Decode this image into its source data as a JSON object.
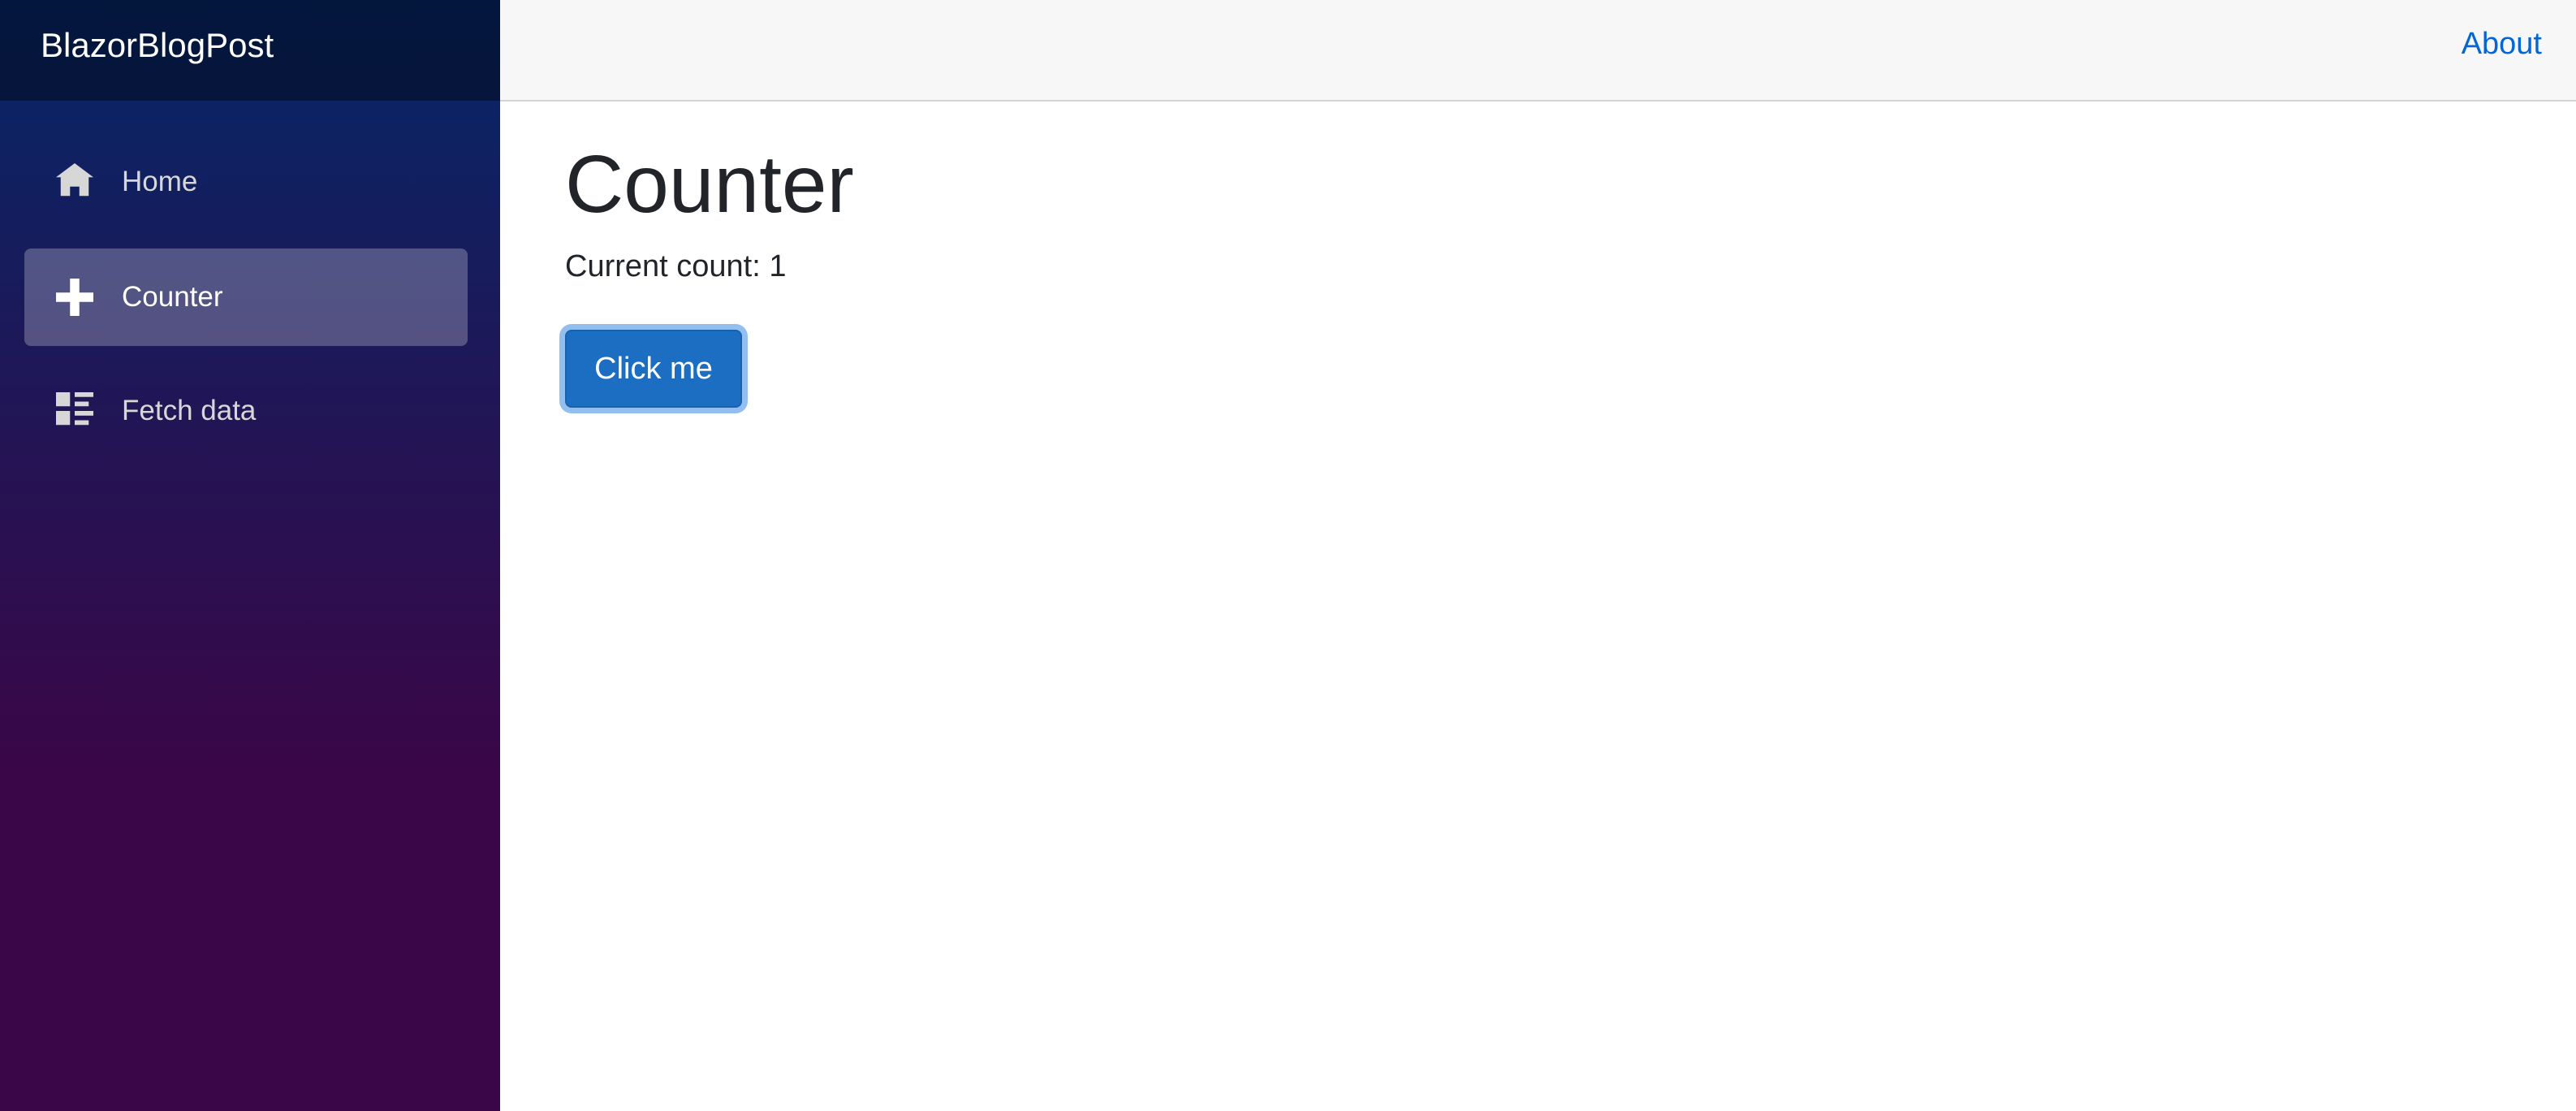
{
  "sidebar": {
    "brand": "BlazorBlogPost",
    "items": [
      {
        "label": "Home",
        "icon": "home-icon",
        "active": false
      },
      {
        "label": "Counter",
        "icon": "plus-icon",
        "active": true
      },
      {
        "label": "Fetch data",
        "icon": "list-rich-icon",
        "active": false
      }
    ]
  },
  "top_row": {
    "about_label": "About"
  },
  "main": {
    "title": "Counter",
    "count_text": "Current count: 1",
    "button_label": "Click me"
  },
  "colors": {
    "sidebar_gradient_top": "#052767",
    "sidebar_gradient_bottom": "#3a0647",
    "link": "#0366d6",
    "button": "#1b6ec2",
    "button_focus_ring": "#93bff0",
    "top_row_bg": "#f7f7f7"
  }
}
